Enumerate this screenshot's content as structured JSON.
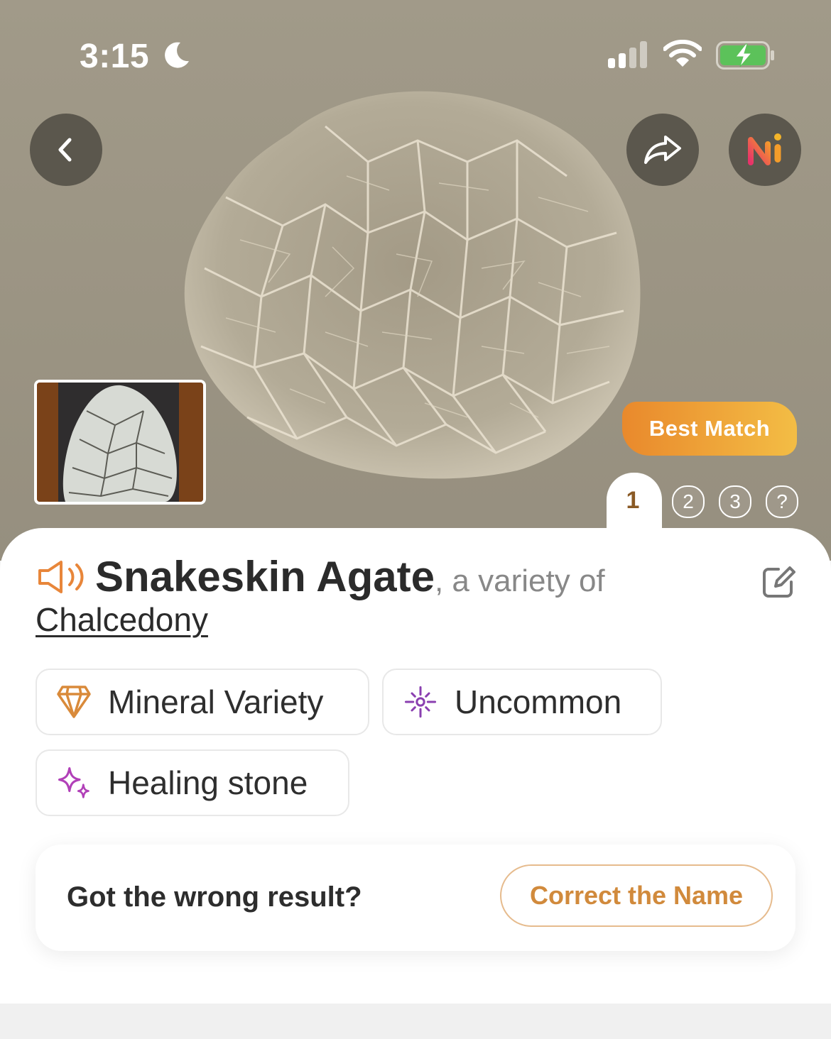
{
  "status_bar": {
    "time": "3:15"
  },
  "hero": {
    "badge": "Best Match",
    "tabs": [
      "1",
      "2",
      "3",
      "?"
    ]
  },
  "result": {
    "name": "Snakeskin Agate",
    "variety_text": ", a variety of",
    "parent": "Chalcedony"
  },
  "tags": [
    {
      "label": "Mineral Variety",
      "icon": "crystal-icon",
      "color": "#d98a3a"
    },
    {
      "label": "Uncommon",
      "icon": "rarity-sparkle-icon",
      "color": "#8a3fb0"
    },
    {
      "label": "Healing stone",
      "icon": "sparkles-icon",
      "color": "#b140b8"
    }
  ],
  "feedback": {
    "prompt": "Got the wrong result?",
    "button": "Correct the Name"
  },
  "colors": {
    "accent": "#e9892c",
    "brand_orange": "#f3bd45",
    "button_text": "#d18a3c"
  }
}
